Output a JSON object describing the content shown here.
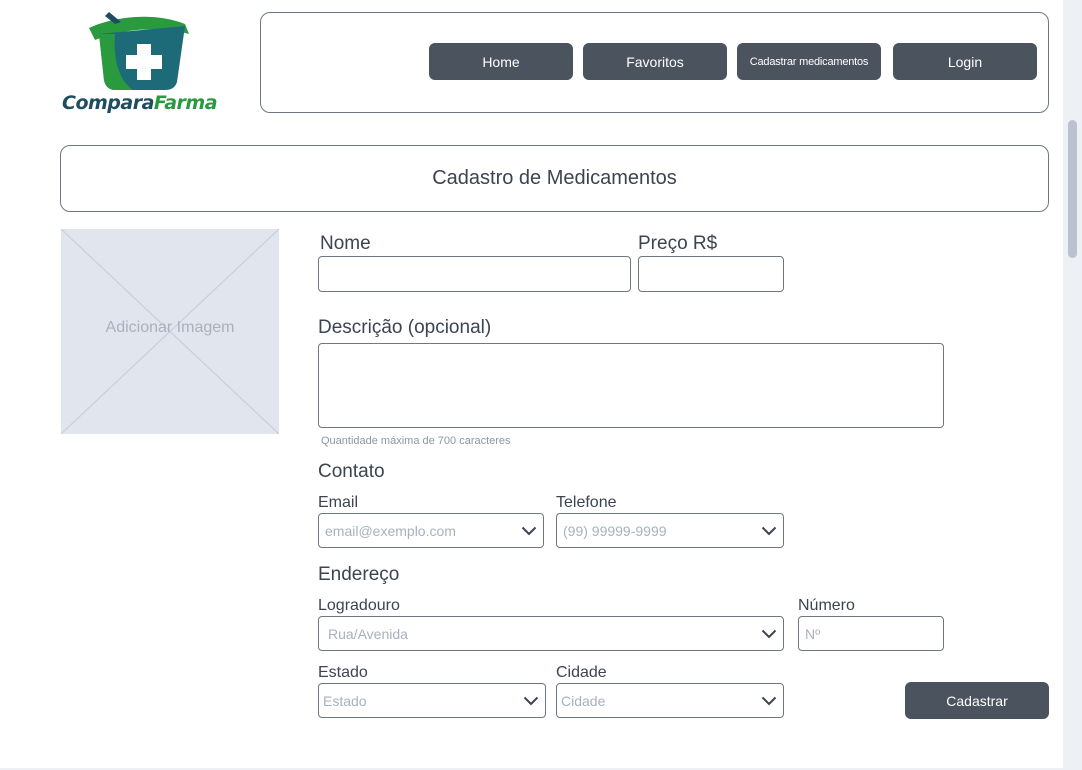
{
  "brand": {
    "name_part1": "Compara",
    "name_part2": "Farma",
    "colors": {
      "dark": "#1d4d5f",
      "green": "#2a9a3e"
    }
  },
  "nav": {
    "home": "Home",
    "favoritos": "Favoritos",
    "cadastrar": "Cadastrar medicamentos",
    "login": "Login"
  },
  "page": {
    "title": "Cadastro de Medicamentos"
  },
  "image": {
    "label": "Adicionar Imagem"
  },
  "form": {
    "nome_label": "Nome",
    "preco_label": "Preço  R$",
    "descricao_label": "Descrição (opcional)",
    "descricao_hint": "Quantidade máxima de 700 caracteres",
    "contato_title": "Contato",
    "email_label": "Email",
    "email_placeholder": "email@exemplo.com",
    "telefone_label": "Telefone",
    "telefone_placeholder": "(99) 99999-9999",
    "endereco_title": "Endereço",
    "logradouro_label": "Logradouro",
    "logradouro_placeholder": "Rua/Avenida",
    "numero_label": "Número",
    "numero_placeholder": "Nº",
    "estado_label": "Estado",
    "estado_placeholder": "Estado",
    "cidade_label": "Cidade",
    "cidade_placeholder": "Cidade",
    "submit": "Cadastrar"
  },
  "icons": {
    "logo": "basket-cross-logo-icon",
    "chevron": "chevron-down-icon"
  },
  "theme": {
    "button_bg": "#4b535e",
    "border": "#6f7882",
    "placeholder_bg": "#e1e6ee"
  }
}
